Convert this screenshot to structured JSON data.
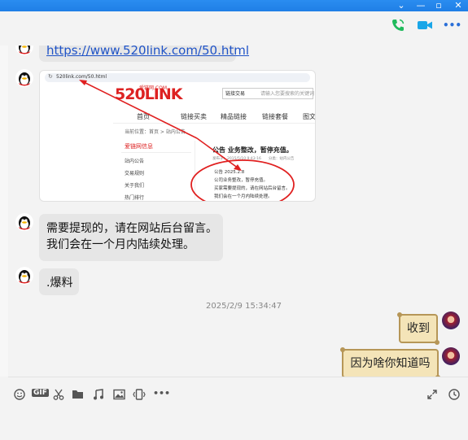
{
  "window": {
    "minimize_icon": "—",
    "restore_icon": "▫",
    "close_icon": "✕",
    "dropdown_icon": "⌄"
  },
  "header": {
    "more_icon": "•••"
  },
  "messages": {
    "link_url": "https://www.520link.com/50.html",
    "screenshot": {
      "address": "520link.com/50.html",
      "logo_text": "520LINK",
      "logo_small": "爱链网.COM",
      "search_placeholder": "请输入您要搜索的关键词",
      "search_select": "链接交易",
      "nav": [
        "首页",
        "链接买卖",
        "精品链接",
        "链接套餐",
        "图文广告"
      ],
      "breadcrumb": "当前位置：首页 > 站内公告",
      "sidebar_title": "爱链网信息",
      "sidebar_items": [
        "站内公告",
        "交易规则",
        "关于我们",
        "热门排行"
      ],
      "article_title": "公告 业务整改，暂停充值。",
      "article_meta": "发布于：2015/5/10 9:43:16　　分类：站内公告",
      "article_lines": [
        "公告 2025.2.8",
        "公司业务整改，暂停充值。",
        "买家需要提现的，请在网站后台留言。",
        "我们会在一个月内陆续处理。"
      ]
    },
    "text1_line1": "需要提现的，请在网站后台留言。",
    "text1_line2": "我们会在一个月内陆续处理。",
    "text2": ".爆料",
    "timestamp": "2025/2/9 15:34:47",
    "reply1": "收到",
    "reply2": "因为啥你知道吗"
  },
  "toolbar": {
    "gif_label": "GIF",
    "more_label": "•••"
  },
  "colors": {
    "title_bar": "#2a8df0",
    "link": "#1f53c7",
    "bubble": "#e6e6e6",
    "parchment": "#f4e4b8",
    "annotation": "#e02020"
  }
}
